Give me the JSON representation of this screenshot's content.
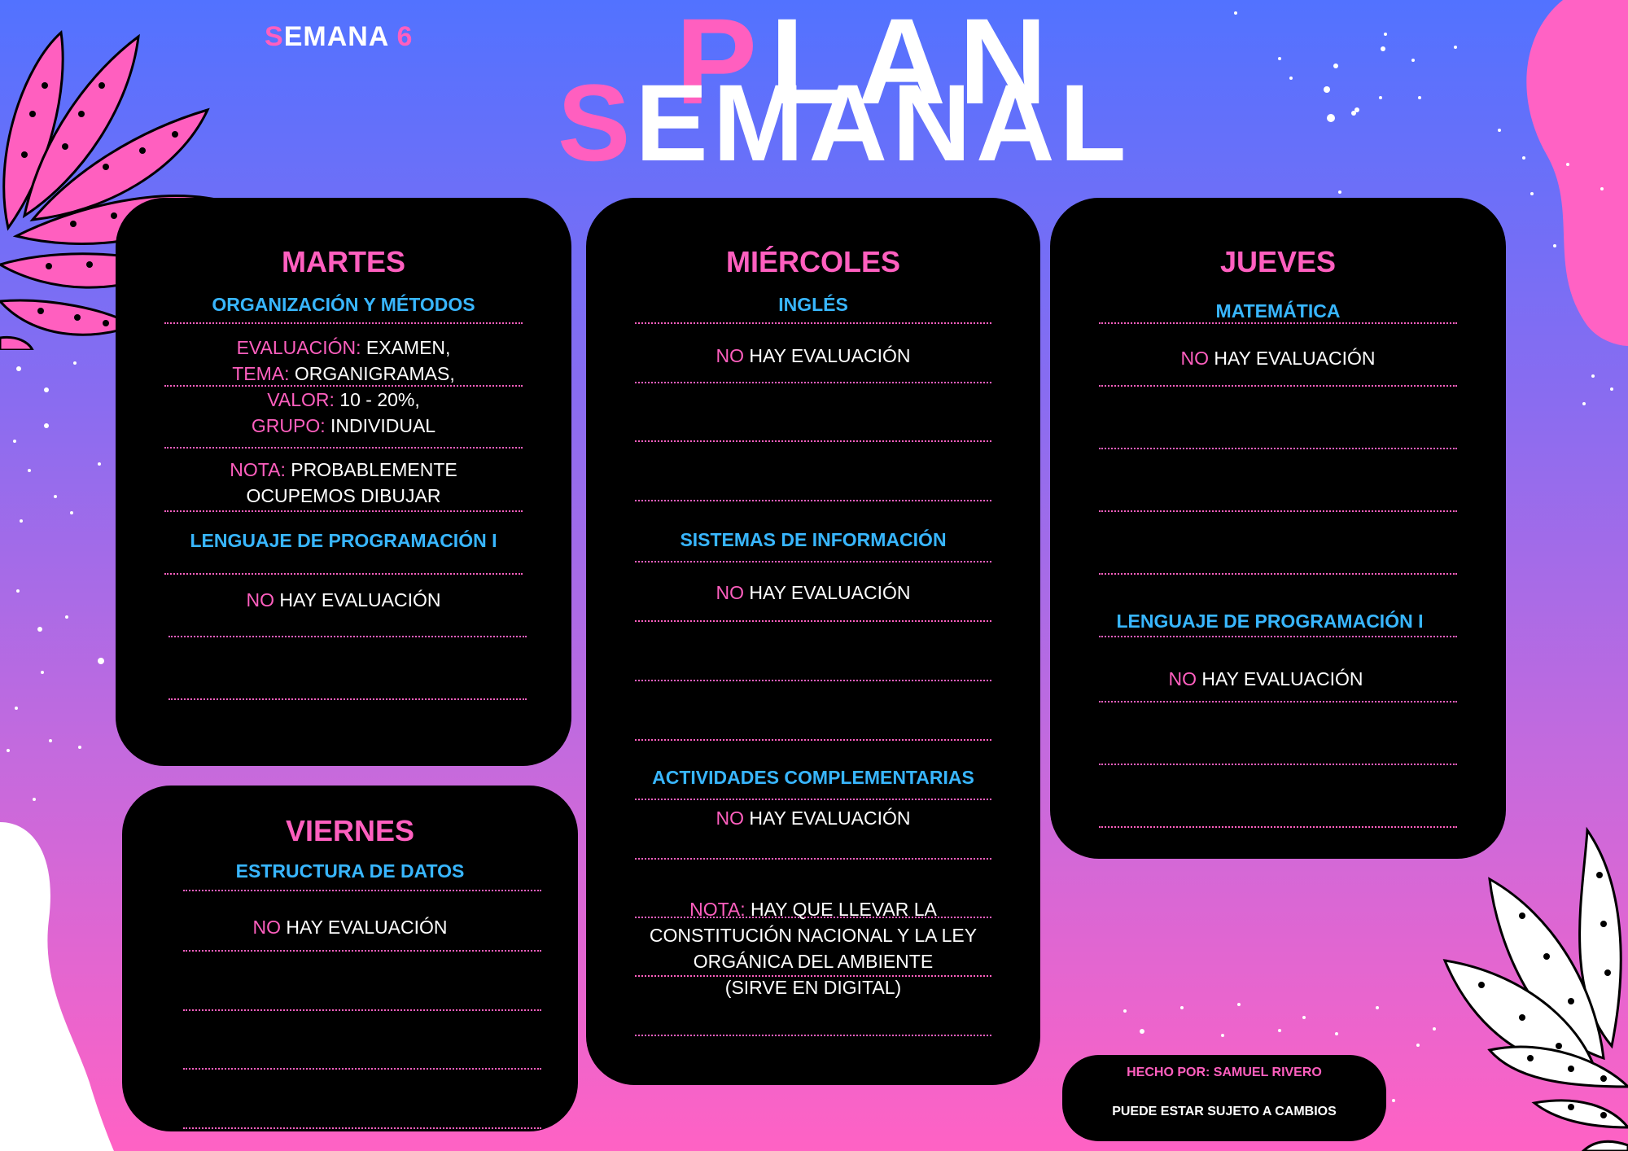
{
  "header": {
    "week_first": "S",
    "week_rest": "EMANA ",
    "week_number": "6",
    "title_line1_first": "P",
    "title_line1_rest": "LAN",
    "title_line2_first": "S",
    "title_line2_rest": "EMANAL"
  },
  "martes": {
    "day": "MARTES",
    "subject1": "ORGANIZACIÓN Y MÉTODOS",
    "eval_label": "EVALUACIÓN:",
    "eval_value": " EXAMEN,",
    "tema_label": "TEMA:",
    "tema_value": " ORGANIGRAMAS,",
    "valor_label": "VALOR:",
    "valor_value": " 10 - 20%,",
    "grupo_label": "GRUPO:",
    "grupo_value": " INDIVIDUAL",
    "nota_label": "NOTA:",
    "nota_value1": " PROBABLEMENTE",
    "nota_value2": "OCUPEMOS DIBUJAR",
    "subject2": "LENGUAJE DE PROGRAMACIÓN I",
    "no": "NO",
    "hay": " HAY EVALUACIÓN"
  },
  "miercoles": {
    "day": "MIÉRCOLES",
    "subject1": "INGLÉS",
    "subject2": "SISTEMAS DE INFORMACIÓN",
    "subject3": "ACTIVIDADES COMPLEMENTARIAS",
    "no": "NO",
    "hay": " HAY EVALUACIÓN",
    "nota_label": "NOTA:",
    "nota_l1": " HAY QUE LLEVAR LA",
    "nota_l2": "CONSTITUCIÓN NACIONAL Y LA LEY",
    "nota_l3": "ORGÁNICA DEL AMBIENTE",
    "nota_l4": "(SIRVE EN DIGITAL)"
  },
  "jueves": {
    "day": "JUEVES",
    "subject1": "MATEMÁTICA",
    "subject2": "LENGUAJE DE PROGRAMACIÓN I",
    "no": "NO",
    "hay": " HAY EVALUACIÓN"
  },
  "viernes": {
    "day": "VIERNES",
    "subject1": "ESTRUCTURA DE DATOS",
    "no": "NO",
    "hay": " HAY EVALUACIÓN"
  },
  "footer": {
    "author": "HECHO POR: SAMUEL RIVERO",
    "disclaimer": "PUEDE ESTAR SUJETO A CAMBIOS"
  },
  "colors": {
    "pink": "#ff5fbf",
    "blue": "#38b6ff",
    "card": "#000000",
    "bg_top": "#5272ff",
    "bg_bottom": "#ff62c4"
  }
}
